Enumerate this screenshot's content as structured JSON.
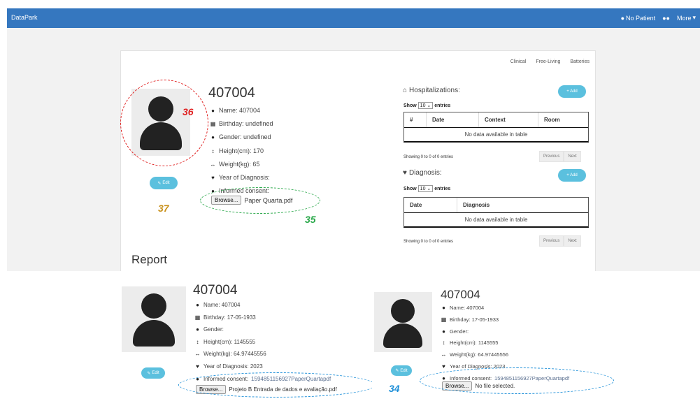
{
  "navbar": {
    "brand": "DataPark",
    "patient": "No Patient",
    "more": "More"
  },
  "tabs": [
    "Clinical",
    "Free-Living",
    "Batteries"
  ],
  "main": {
    "patient_id": "407004",
    "name": "Name: 407004",
    "birthday": "Birthday: undefined",
    "gender": "Gender: undefined",
    "height": "Height(cm): 170",
    "weight": "Weight(kg): 65",
    "diagnosis_year": "Year of Diagnosis:",
    "consent": "Informed consent:",
    "browse_label": "Browse...",
    "file_name": "Paper Quarta.pdf",
    "edit_label": "Edit"
  },
  "hospitalizations": {
    "title": "Hospitalizations:",
    "add_label": "+ Add",
    "show_pre": "Show",
    "show_value": "10",
    "show_post": "entries",
    "columns": [
      "#",
      "Date",
      "Context",
      "Room"
    ],
    "empty": "No data available in table",
    "showing": "Showing 0 to 0 of 0 entries",
    "prev": "Previous",
    "next": "Next"
  },
  "diagnosis": {
    "title": "Diagnosis:",
    "add_label": "+ Add",
    "show_pre": "Show",
    "show_value": "10",
    "show_post": "entries",
    "columns": [
      "Date",
      "Diagnosis"
    ],
    "empty": "No data available in table",
    "showing": "Showing 0 to 0 of 0 entries",
    "prev": "Previous",
    "next": "Next"
  },
  "report_title": "Report",
  "left_shot": {
    "patient_id": "407004",
    "name": "Name: 407004",
    "birthday": "Birthday: 17-05-1933",
    "gender": "Gender:",
    "height": "Height(cm): 1145555",
    "weight": "Weight(kg): 64.97445556",
    "diagnosis_year": "Year of Diagnosis: 2023",
    "consent_label": "Informed consent:",
    "consent_file": "1594851156927PaperQuartapdf",
    "browse_label": "Browse...",
    "file_name": "Projeto B Entrada de dados e avaliação.pdf",
    "edit_label": "Edit"
  },
  "right_shot": {
    "patient_id": "407004",
    "name": "Name: 407004",
    "birthday": "Birthday: 17-05-1933",
    "gender": "Gender:",
    "height": "Height(cm): 1145555",
    "weight": "Weight(kg): 64.97445556",
    "diagnosis_year": "Year of Diagnosis: 2023",
    "consent_label": "Informed consent:",
    "consent_file": "1594851156927PaperQuartapdf",
    "browse_label": "Browse...",
    "file_name": "No file selected.",
    "edit_label": "Edit"
  },
  "annotations": [
    "36",
    "37",
    "35",
    "34"
  ],
  "colors": {
    "navbar": "#3577bf",
    "accent": "#5bc0de",
    "red_annot": "#e02020",
    "green_annot": "#2aa84a",
    "blue_annot": "#1d8fd8",
    "orange_annot": "#c8901a"
  }
}
